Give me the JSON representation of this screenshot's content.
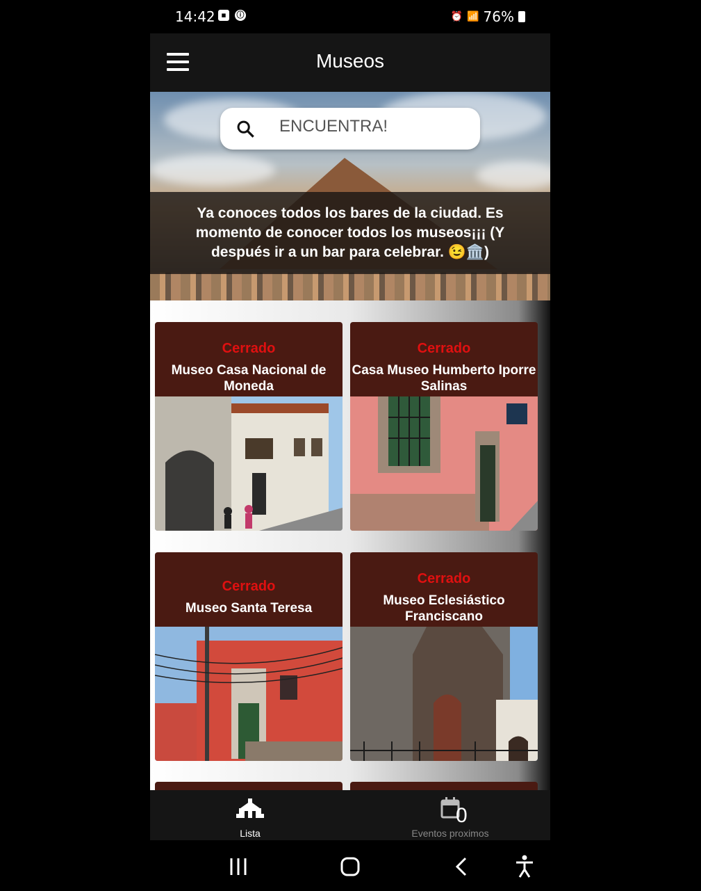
{
  "status_bar": {
    "time": "14:42",
    "battery": "76%"
  },
  "app_bar": {
    "title": "Museos",
    "menu_icon": "menu-icon"
  },
  "hero": {
    "search_placeholder": "ENCUENTRA!",
    "banner_text": "Ya conoces todos los bares de la ciudad. Es momento de conocer todos los museos¡¡¡ (Y después ir a un bar para celebrar. 😉🏛️)"
  },
  "museums": [
    {
      "status": "Cerrado",
      "name": "Museo Casa Nacional de Moneda"
    },
    {
      "status": "Cerrado",
      "name": "Casa Museo Humberto Iporre Salinas"
    },
    {
      "status": "Cerrado",
      "name": "Museo Santa Teresa"
    },
    {
      "status": "Cerrado",
      "name": "Museo Eclesiástico Franciscano"
    }
  ],
  "bottom_nav": [
    {
      "label": "Lista",
      "icon": "museum-icon",
      "active": true
    },
    {
      "label": "Eventos proximos",
      "icon": "calendar-icon",
      "badge": "0",
      "active": false
    }
  ],
  "colors": {
    "card_bg": "#4a1a12",
    "status_closed": "#e01010",
    "bar_bg": "#151515"
  }
}
